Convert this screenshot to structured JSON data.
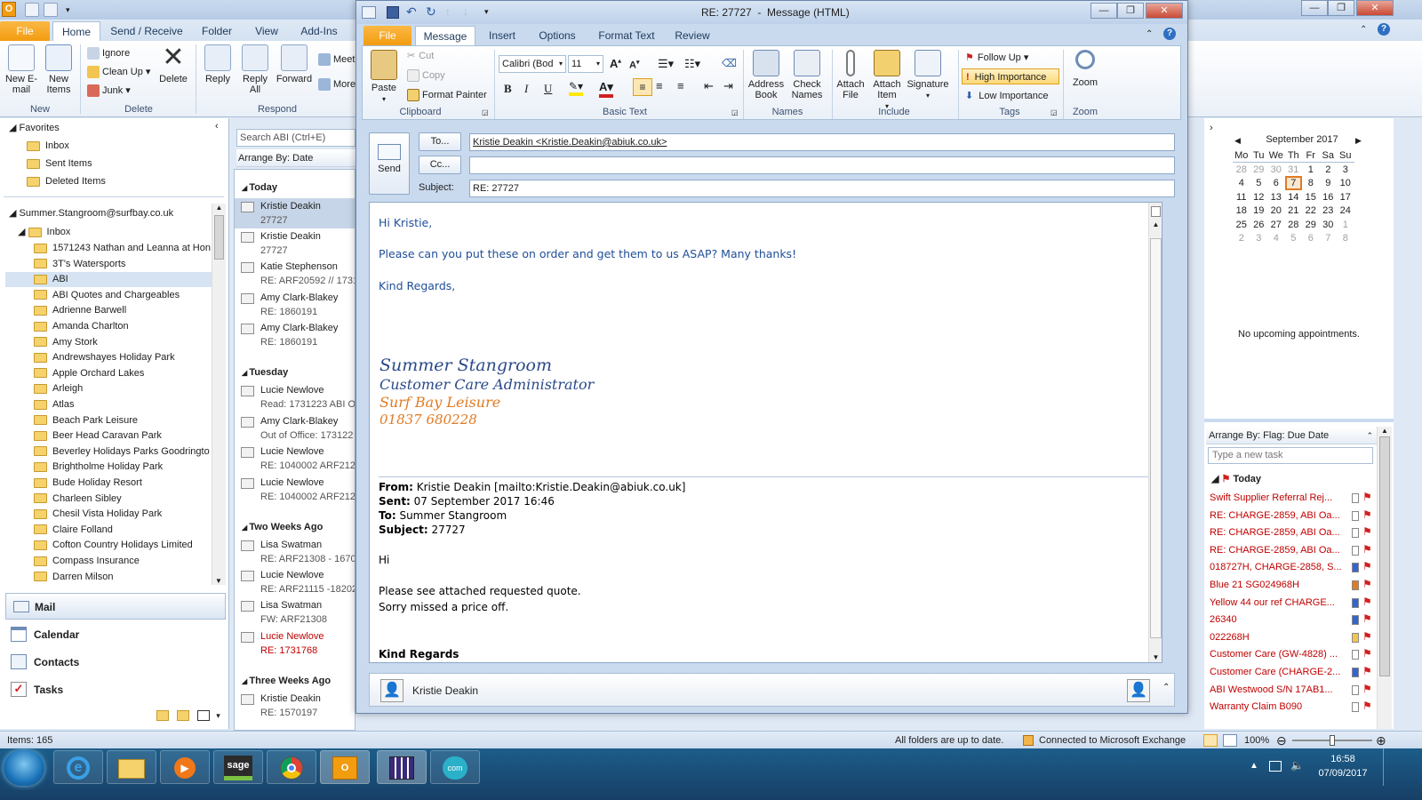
{
  "main_window": {
    "tabs": [
      "File",
      "Home",
      "Send / Receive",
      "Folder",
      "View",
      "Add-Ins"
    ],
    "ribbon": {
      "new_email": "New E-mail",
      "new_items": "New Items",
      "ignore": "Ignore",
      "clean_up": "Clean Up",
      "junk": "Junk",
      "delete": "Delete",
      "reply": "Reply",
      "reply_all": "Reply All",
      "forward": "Forward",
      "meeting": "Meet",
      "more": "More",
      "groups": {
        "new": "New",
        "delete": "Delete",
        "respond": "Respond"
      }
    }
  },
  "folder_pane": {
    "favorites_label": "Favorites",
    "favorites": [
      "Inbox",
      "Sent Items",
      "Deleted Items"
    ],
    "account": "Summer.Stangroom@surfbay.co.uk",
    "inbox_label": "Inbox",
    "folders": [
      "1571243 Nathan and Leanna at Hon",
      "3T's Watersports",
      "ABI",
      "ABI Quotes and Chargeables",
      "Adrienne Barwell",
      "Amanda Charlton",
      "Amy Stork",
      "Andrewshayes Holiday Park",
      "Apple Orchard Lakes",
      "Arleigh",
      "Atlas",
      "Beach Park Leisure",
      "Beer Head Caravan Park",
      "Beverley Holidays Parks Goodringto",
      "Brightholme Holiday Park",
      "Bude Holiday Resort",
      "Charleen Sibley",
      "Chesil Vista Holiday Park",
      "Claire Folland",
      "Cofton Country Holidays Limited",
      "Compass Insurance",
      "Darren Milson"
    ],
    "nav": [
      "Mail",
      "Calendar",
      "Contacts",
      "Tasks"
    ]
  },
  "message_list": {
    "search_placeholder": "Search ABI (Ctrl+E)",
    "arrange": "Arrange By: Date",
    "groups": [
      {
        "label": "Today",
        "items": [
          {
            "from": "Kristie Deakin",
            "subject": "27727",
            "selected": true
          },
          {
            "from": "Kristie Deakin",
            "subject": "27727"
          },
          {
            "from": "Katie Stephenson",
            "subject": "RE: ARF20592  // 1731"
          },
          {
            "from": "Amy Clark-Blakey",
            "subject": "RE: 1860191"
          },
          {
            "from": "Amy Clark-Blakey",
            "subject": "RE: 1860191"
          }
        ]
      },
      {
        "label": "Tuesday",
        "items": [
          {
            "from": "Lucie Newlove",
            "subject": "Read: 1731223 ABI Oa"
          },
          {
            "from": "Amy Clark-Blakey",
            "subject": "Out of Office: 173122"
          },
          {
            "from": "Lucie Newlove",
            "subject": "RE: 1040002 ARF2121"
          },
          {
            "from": "Lucie Newlove",
            "subject": "RE: 1040002 ARF2121"
          }
        ]
      },
      {
        "label": "Two Weeks Ago",
        "items": [
          {
            "from": "Lisa Swatman",
            "subject": "RE: ARF21308 - 16705"
          },
          {
            "from": "Lucie Newlove",
            "subject": "RE: ARF21115 -182029"
          },
          {
            "from": "Lisa Swatman",
            "subject": "FW: ARF21308"
          },
          {
            "from": "Lucie Newlove",
            "subject": "RE: 1731768",
            "red": true
          }
        ]
      },
      {
        "label": "Three Weeks Ago",
        "items": [
          {
            "from": "Kristie Deakin",
            "subject": "RE: 1570197"
          }
        ]
      }
    ]
  },
  "right_pane": {
    "month": "September 2017",
    "weekdays": [
      "Mo",
      "Tu",
      "We",
      "Th",
      "Fr",
      "Sa",
      "Su"
    ],
    "weeks": [
      [
        "28",
        "29",
        "30",
        "31",
        "1",
        "2",
        "3"
      ],
      [
        "4",
        "5",
        "6",
        "7",
        "8",
        "9",
        "10"
      ],
      [
        "11",
        "12",
        "13",
        "14",
        "15",
        "16",
        "17"
      ],
      [
        "18",
        "19",
        "20",
        "21",
        "22",
        "23",
        "24"
      ],
      [
        "25",
        "26",
        "27",
        "28",
        "29",
        "30",
        "1"
      ],
      [
        "2",
        "3",
        "4",
        "5",
        "6",
        "7",
        "8"
      ]
    ],
    "no_appointments": "No upcoming appointments.",
    "arrange": "Arrange By: Flag: Due Date",
    "new_task_placeholder": "Type a new task",
    "today_label": "Today",
    "tasks": [
      "Swift Supplier Referral Rej...",
      "RE: CHARGE-2859, ABI Oa...",
      "RE: CHARGE-2859, ABI Oa...",
      "RE: CHARGE-2859, ABI Oa...",
      "018727H, CHARGE-2858, S...",
      "Blue 21 SG024968H",
      "Yellow 44 our ref CHARGE...",
      "26340",
      "022268H",
      "Customer Care (GW-4828) ...",
      "Customer Care (CHARGE-2...",
      "ABI Westwood S/N 17AB1...",
      "Warranty Claim B090"
    ]
  },
  "status_bar": {
    "items": "Items: 165",
    "sync": "All folders are up to date.",
    "exchange": "Connected to Microsoft Exchange",
    "zoom": "100%"
  },
  "taskbar": {
    "time": "16:58",
    "date": "07/09/2017",
    "apps": [
      "windows-start",
      "internet-explorer",
      "file-explorer",
      "media-player",
      "sage",
      "chrome",
      "outlook",
      "app-grid",
      "com-app"
    ]
  },
  "message_window": {
    "title": "RE: 27727  -  Message (HTML)",
    "tabs": [
      "File",
      "Message",
      "Insert",
      "Options",
      "Format Text",
      "Review"
    ],
    "ribbon": {
      "paste": "Paste",
      "cut": "Cut",
      "copy": "Copy",
      "format_painter": "Format Painter",
      "font": "Calibri (Bod",
      "size": "11",
      "address_book": "Address Book",
      "check_names": "Check Names",
      "attach_file": "Attach File",
      "attach_item": "Attach Item",
      "signature": "Signature",
      "follow_up": "Follow Up",
      "high_importance": "High Importance",
      "low_importance": "Low Importance",
      "zoom": "Zoom",
      "groups": {
        "clipboard": "Clipboard",
        "basic_text": "Basic Text",
        "names": "Names",
        "include": "Include",
        "tags": "Tags",
        "zoom": "Zoom"
      }
    },
    "send": "Send",
    "to_btn": "To...",
    "cc_btn": "Cc...",
    "subject_label": "Subject:",
    "to_value": "Kristie Deakin <Kristie.Deakin@abiuk.co.uk>",
    "cc_value": "",
    "subject_value": "RE: 27727",
    "body": {
      "greeting": "Hi Kristie,",
      "line1": "Please can you put these on order and get them to us ASAP? Many thanks!",
      "closing": "Kind Regards,",
      "sig_name": "Summer Stangroom",
      "sig_title": "Customer Care Administrator",
      "sig_company": "Surf Bay Leisure",
      "sig_phone": "01837 680228",
      "from_label": "From:",
      "from_value": " Kristie Deakin [mailto:Kristie.Deakin@abiuk.co.uk]",
      "sent_label": "Sent:",
      "sent_value": " 07 September 2017 16:46",
      "to_label": "To:",
      "to_value": " Summer Stangroom",
      "subj_label": "Subject:",
      "subj_value": " 27727",
      "q_hi": "Hi",
      "q_line1": "Please see attached requested quote.",
      "q_line2": "Sorry missed a price off.",
      "q_regards": "Kind Regards"
    },
    "people_pane": "Kristie Deakin"
  },
  "colors": {
    "accent_file": "#f29c10",
    "body_blue": "#1f4e99",
    "sig_blue": "#2b4a8a",
    "sig_orange": "#e07b24",
    "task_red": "#c00000"
  }
}
